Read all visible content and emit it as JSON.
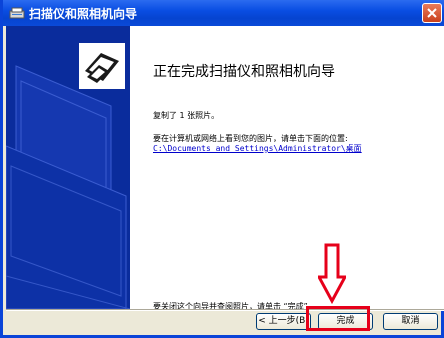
{
  "window": {
    "title": "扫描仪和照相机向导",
    "close_icon": "close-icon"
  },
  "wizard": {
    "heading": "正在完成扫描仪和照相机向导",
    "copied_text": "复制了 1 张照片。",
    "location_note": "要在计算机或网络上看到您的图片，请单击下面的位置:",
    "location_link": "C:\\Documents and Settings\\Administrator\\桌面",
    "close_hint": "要关闭这个向导并查阅照片，请单击 “完成”。"
  },
  "buttons": {
    "back": "< 上一步(B)",
    "finish": "完成",
    "cancel": "取消"
  },
  "colors": {
    "title_bar": "#0a4ee3",
    "left_panel": "#0a2c9c",
    "annotation": "#e6001a",
    "link": "#0000cc"
  }
}
